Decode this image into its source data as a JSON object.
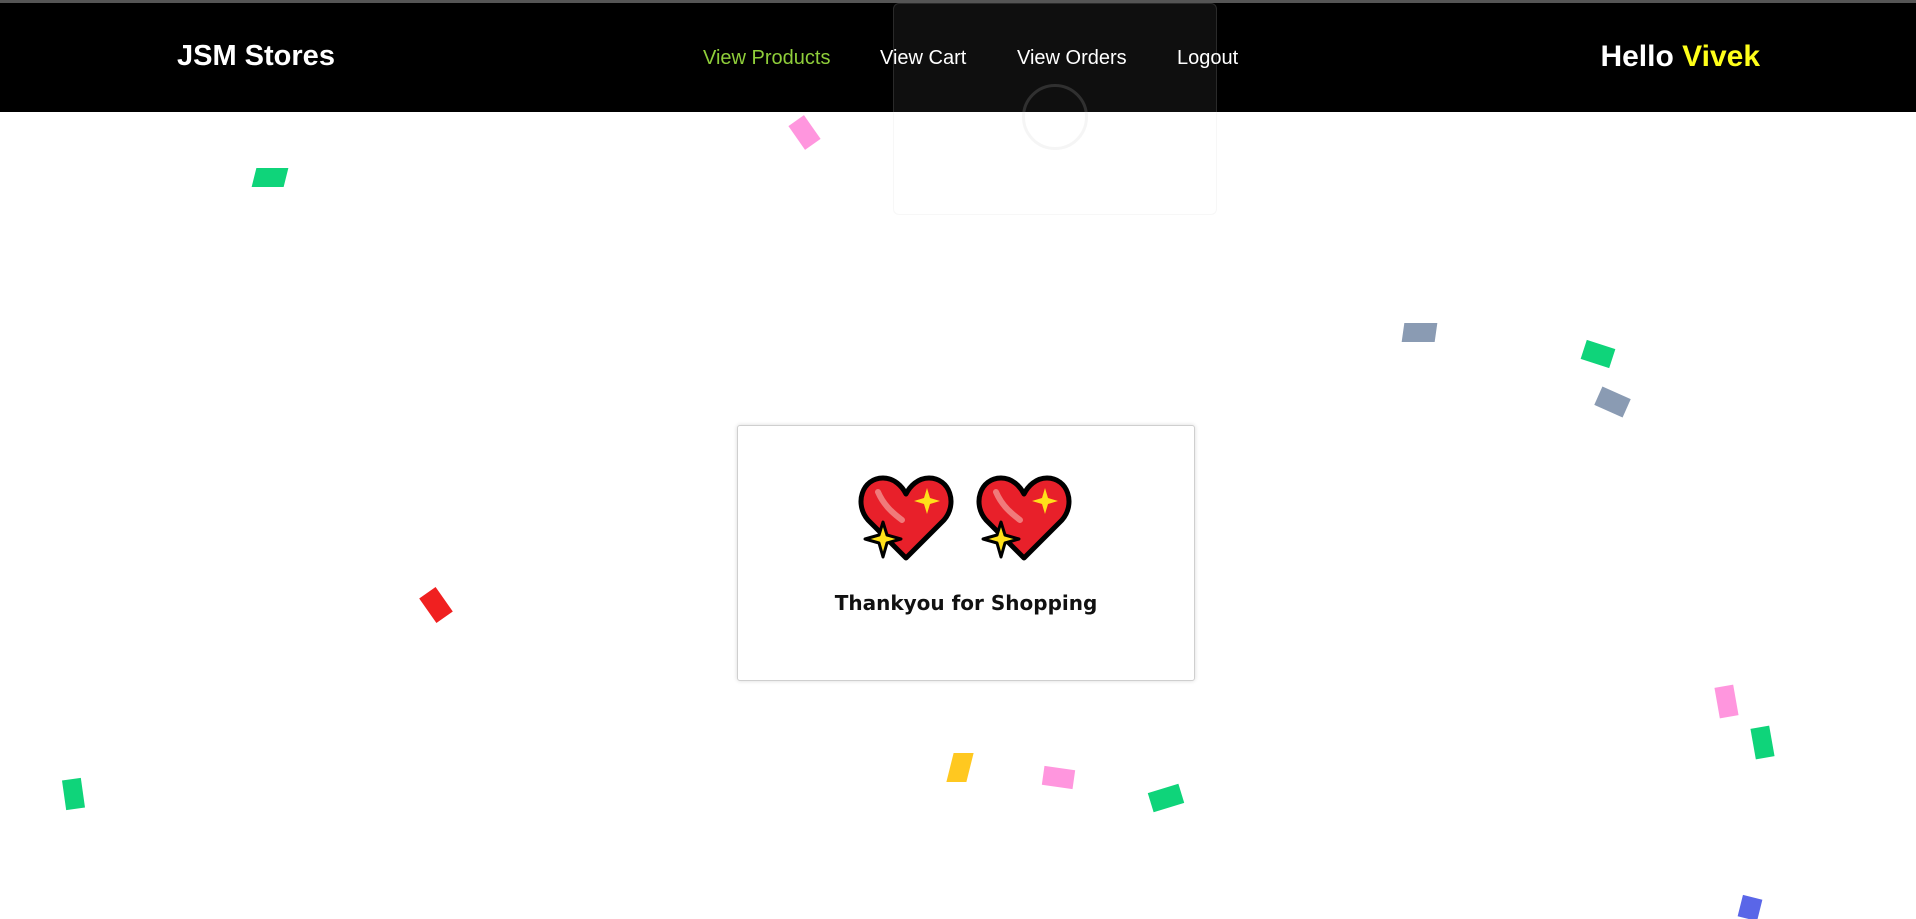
{
  "header": {
    "brand": "JSM Stores",
    "nav": [
      {
        "label": "View Products",
        "active": true
      },
      {
        "label": "View Cart",
        "active": false
      },
      {
        "label": "View Orders",
        "active": false
      },
      {
        "label": "Logout",
        "active": false
      }
    ],
    "greeting_prefix": "Hello",
    "username": "Vivek"
  },
  "modal": {
    "icons": [
      "sparkling-heart-icon",
      "sparkling-heart-icon"
    ],
    "message": "Thankyou for Shopping"
  },
  "colors": {
    "header_bg": "#000000",
    "nav_active": "#8fce3a",
    "nav_text": "#ffffff",
    "username": "#ffff1a",
    "heart_red": "#e8202a",
    "sparkle_yellow": "#ffe01a",
    "confetti": [
      "#0fd47a",
      "#ff96de",
      "#8a9bb3",
      "#f02020",
      "#ffc820",
      "#5a66e8"
    ]
  }
}
